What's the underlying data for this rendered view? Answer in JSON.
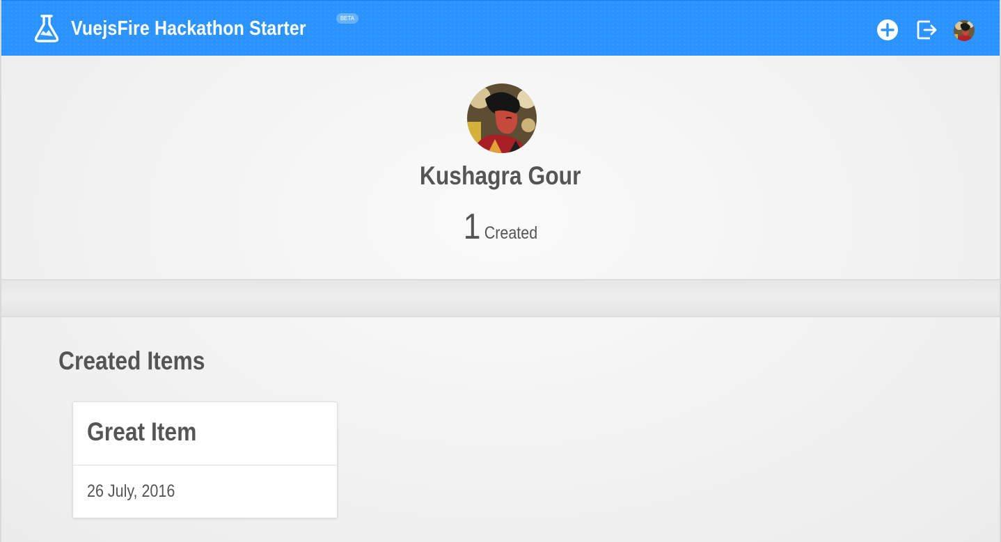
{
  "header": {
    "title": "VuejsFire Hackathon Starter",
    "badge": "BETA",
    "brand_icon": "flask-icon",
    "actions": [
      {
        "name": "add-item",
        "icon": "plus-circle-icon"
      },
      {
        "name": "logout",
        "icon": "logout-icon"
      },
      {
        "name": "user-avatar",
        "icon": "avatar"
      }
    ],
    "accent_color": "#2a93ff"
  },
  "profile": {
    "name": "Kushagra Gour",
    "created_count": "1",
    "created_label": "Created"
  },
  "created_items": {
    "heading": "Created Items",
    "items": [
      {
        "title": "Great Item",
        "date": "26 July, 2016"
      }
    ]
  },
  "colors": {
    "text": "#555555",
    "background": "#f2f2f2",
    "card": "#ffffff"
  }
}
